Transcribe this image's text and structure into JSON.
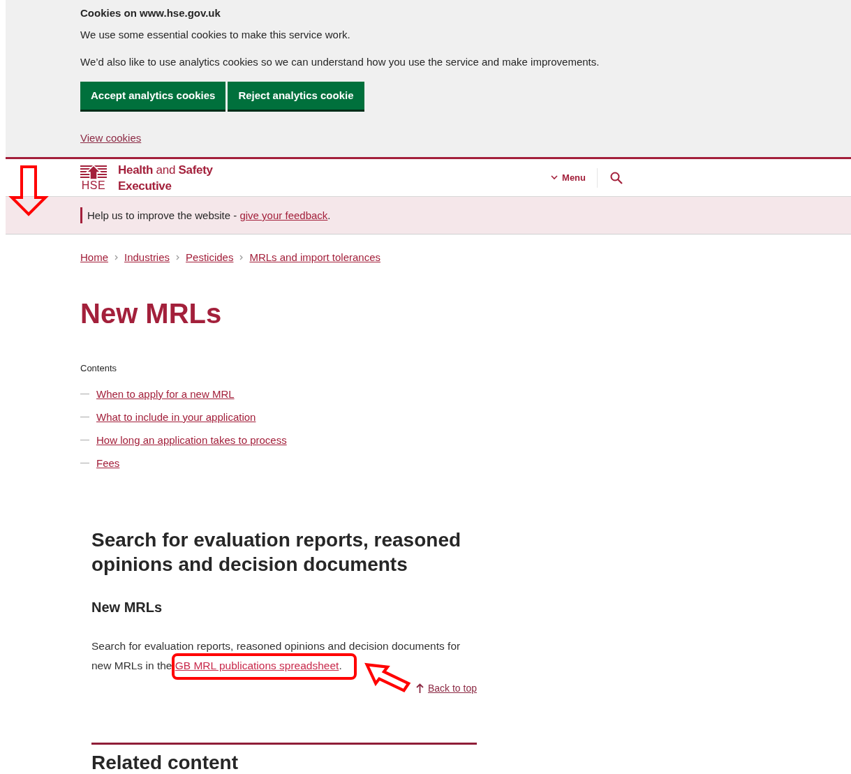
{
  "cookie_banner": {
    "title": "Cookies on www.hse.gov.uk",
    "paragraphs": [
      "We use some essential cookies to make this service work.",
      "We’d also like to use analytics cookies so we can understand how you use the service and make improvements."
    ],
    "buttons": [
      "Accept analytics cookies",
      "Reject analytics cookie"
    ],
    "link": "View cookies"
  },
  "header": {
    "logo_mark": "HSE",
    "logo_line_1": "**Health** and **Safety**",
    "logo_line_2": "Executive",
    "menu": "Menu"
  },
  "feedback": {
    "text": "Help us to improve the website - ",
    "link": "give your feedback",
    "after": "."
  },
  "breadcrumbs": [
    "Home",
    "Industries",
    "Pesticides",
    "MRLs and import tolerances"
  ],
  "title": "New MRLs",
  "contents": {
    "heading": "Contents",
    "items": [
      "When to apply for a new MRL",
      "What to include in your application",
      "How long an application takes to process",
      "Fees"
    ]
  },
  "section": {
    "title": "Search for evaluation reports, reasoned opinions and decision documents",
    "subtitle": "New MRLs",
    "text": "Search for evaluation reports, reasoned opinions and decision documents for new MRLs in the ",
    "link": "GB MRL publications spreadsheet",
    "after": "."
  },
  "back_to_top": "Back to top",
  "related": {
    "title": "Related content"
  },
  "annotations": [
    {
      "kind": "down-arrow"
    },
    {
      "kind": "highlight-box"
    },
    {
      "kind": "pointer-arrow"
    }
  ]
}
